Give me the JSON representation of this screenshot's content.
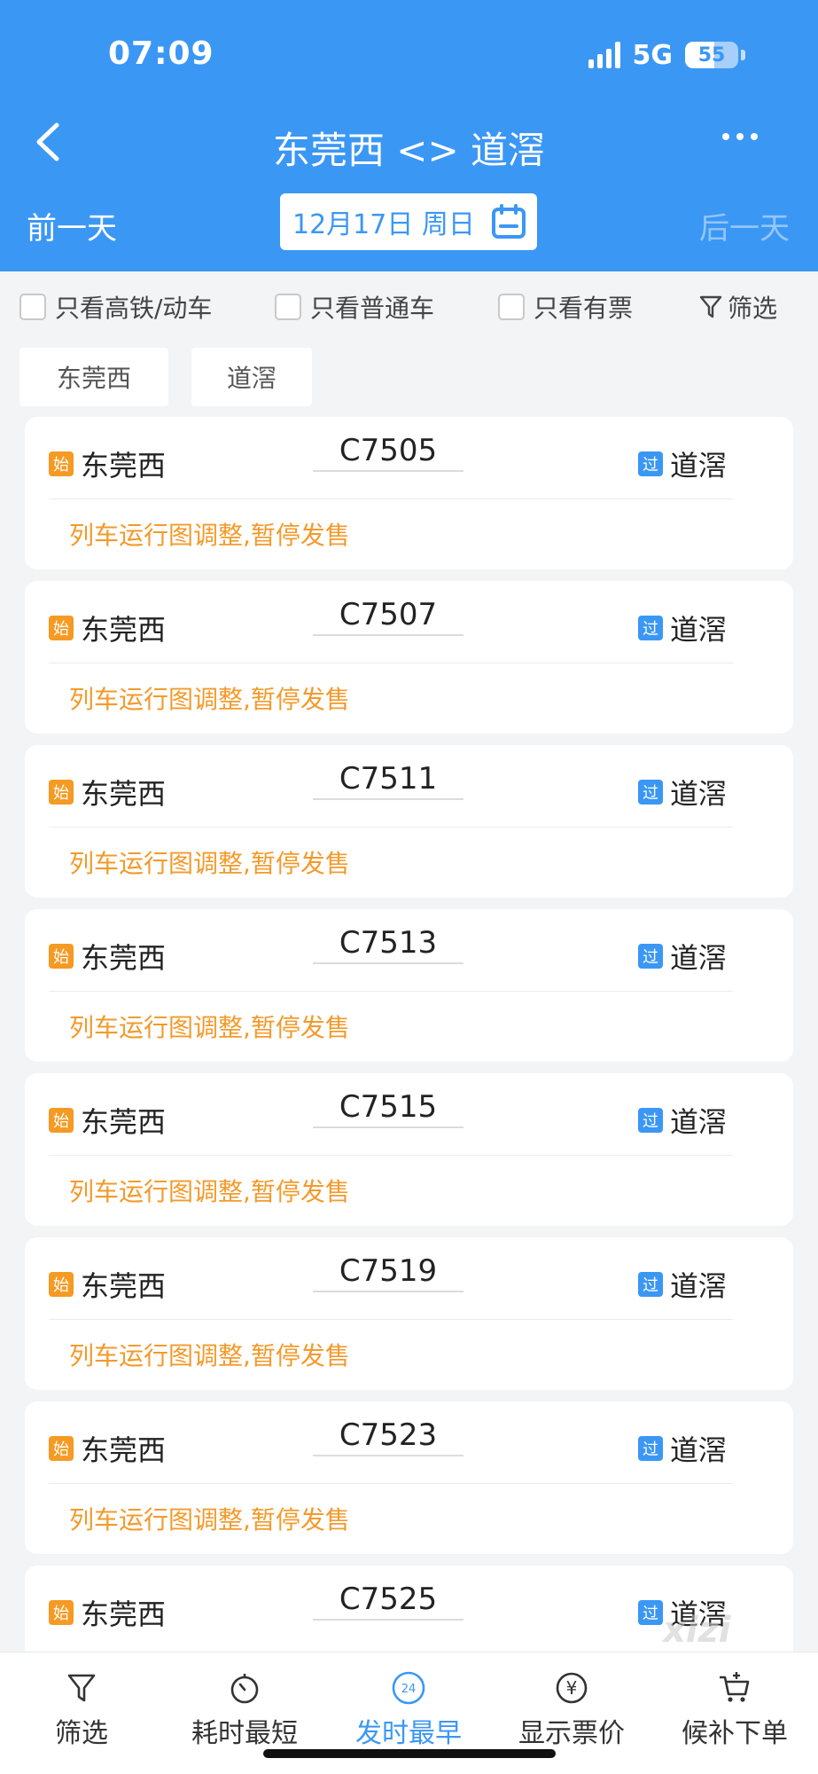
{
  "status": {
    "time": "07:09",
    "network": "5G",
    "battery": "55",
    "battery_level": 0.55
  },
  "header": {
    "title": "东莞西 <> 道滘",
    "prev_day": "前一天",
    "next_day": "后一天",
    "date": "12月17日 周日"
  },
  "filters": {
    "high_speed": "只看高铁/动车",
    "normal": "只看普通车",
    "available": "只看有票",
    "filter": "筛选"
  },
  "stations": {
    "from": "东莞西",
    "to": "道滘"
  },
  "badges": {
    "start": "始",
    "pass": "过"
  },
  "trains": [
    {
      "no": "C7505",
      "from": "东莞西",
      "to": "道滘",
      "notice": "列车运行图调整,暂停发售"
    },
    {
      "no": "C7507",
      "from": "东莞西",
      "to": "道滘",
      "notice": "列车运行图调整,暂停发售"
    },
    {
      "no": "C7511",
      "from": "东莞西",
      "to": "道滘",
      "notice": "列车运行图调整,暂停发售"
    },
    {
      "no": "C7513",
      "from": "东莞西",
      "to": "道滘",
      "notice": "列车运行图调整,暂停发售"
    },
    {
      "no": "C7515",
      "from": "东莞西",
      "to": "道滘",
      "notice": "列车运行图调整,暂停发售"
    },
    {
      "no": "C7519",
      "from": "东莞西",
      "to": "道滘",
      "notice": "列车运行图调整,暂停发售"
    },
    {
      "no": "C7523",
      "from": "东莞西",
      "to": "道滘",
      "notice": "列车运行图调整,暂停发售"
    },
    {
      "no": "C7525",
      "from": "东莞西",
      "to": "道滘",
      "notice": ""
    }
  ],
  "bottom_tabs": {
    "filter": "筛选",
    "shortest": "耗时最短",
    "earliest": "发时最早",
    "earliest_icon_text": "24",
    "price": "显示票价",
    "waitlist": "候补下单"
  },
  "watermark": "xizi",
  "colors": {
    "primary": "#3b97f4",
    "start_badge": "#f59a23",
    "notice": "#f39a2b"
  }
}
